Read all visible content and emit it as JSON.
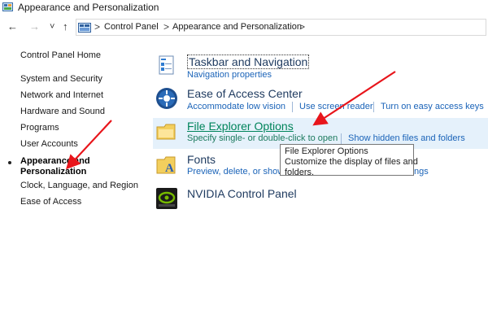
{
  "window": {
    "title": "Appearance and Personalization"
  },
  "address_bar": {
    "crumbs": [
      "Control Panel",
      "Appearance and Personalization"
    ],
    "separator": ">"
  },
  "nav": {
    "back": "←",
    "forward": "→",
    "recent": "˅",
    "up": "↑"
  },
  "sidebar": {
    "items": [
      {
        "label": "Control Panel Home"
      },
      {
        "label": "System and Security"
      },
      {
        "label": "Network and Internet"
      },
      {
        "label": "Hardware and Sound"
      },
      {
        "label": "Programs"
      },
      {
        "label": "User Accounts"
      },
      {
        "label_line1": "Appearance and",
        "label_line2": "Personalization",
        "selected": true
      },
      {
        "label": "Clock, Language, and Region"
      },
      {
        "label": "Ease of Access"
      }
    ]
  },
  "main": {
    "taskbar": {
      "heading": "Taskbar and Navigation",
      "links": [
        "Navigation properties"
      ]
    },
    "ease": {
      "heading": "Ease of Access Center",
      "links": [
        "Accommodate low vision",
        "Use screen reader",
        "Turn on easy access keys"
      ]
    },
    "explorer": {
      "heading": "File Explorer Options",
      "links": [
        "Specify single- or double-click to open",
        "Show hidden files and folders"
      ]
    },
    "fonts": {
      "heading": "Fonts",
      "links": [
        "Preview, delete, or show",
        "ngs"
      ]
    },
    "nvidia": {
      "heading": "NVIDIA Control Panel"
    }
  },
  "tooltip": {
    "title": "File Explorer Options",
    "line1": "Customize the display of files and",
    "line2": "folders."
  },
  "colors": {
    "annotation_arrow": "#e8151b",
    "link": "#1a63b8",
    "highlight_bg": "#e5f1fb",
    "hover_text": "#00845b"
  }
}
